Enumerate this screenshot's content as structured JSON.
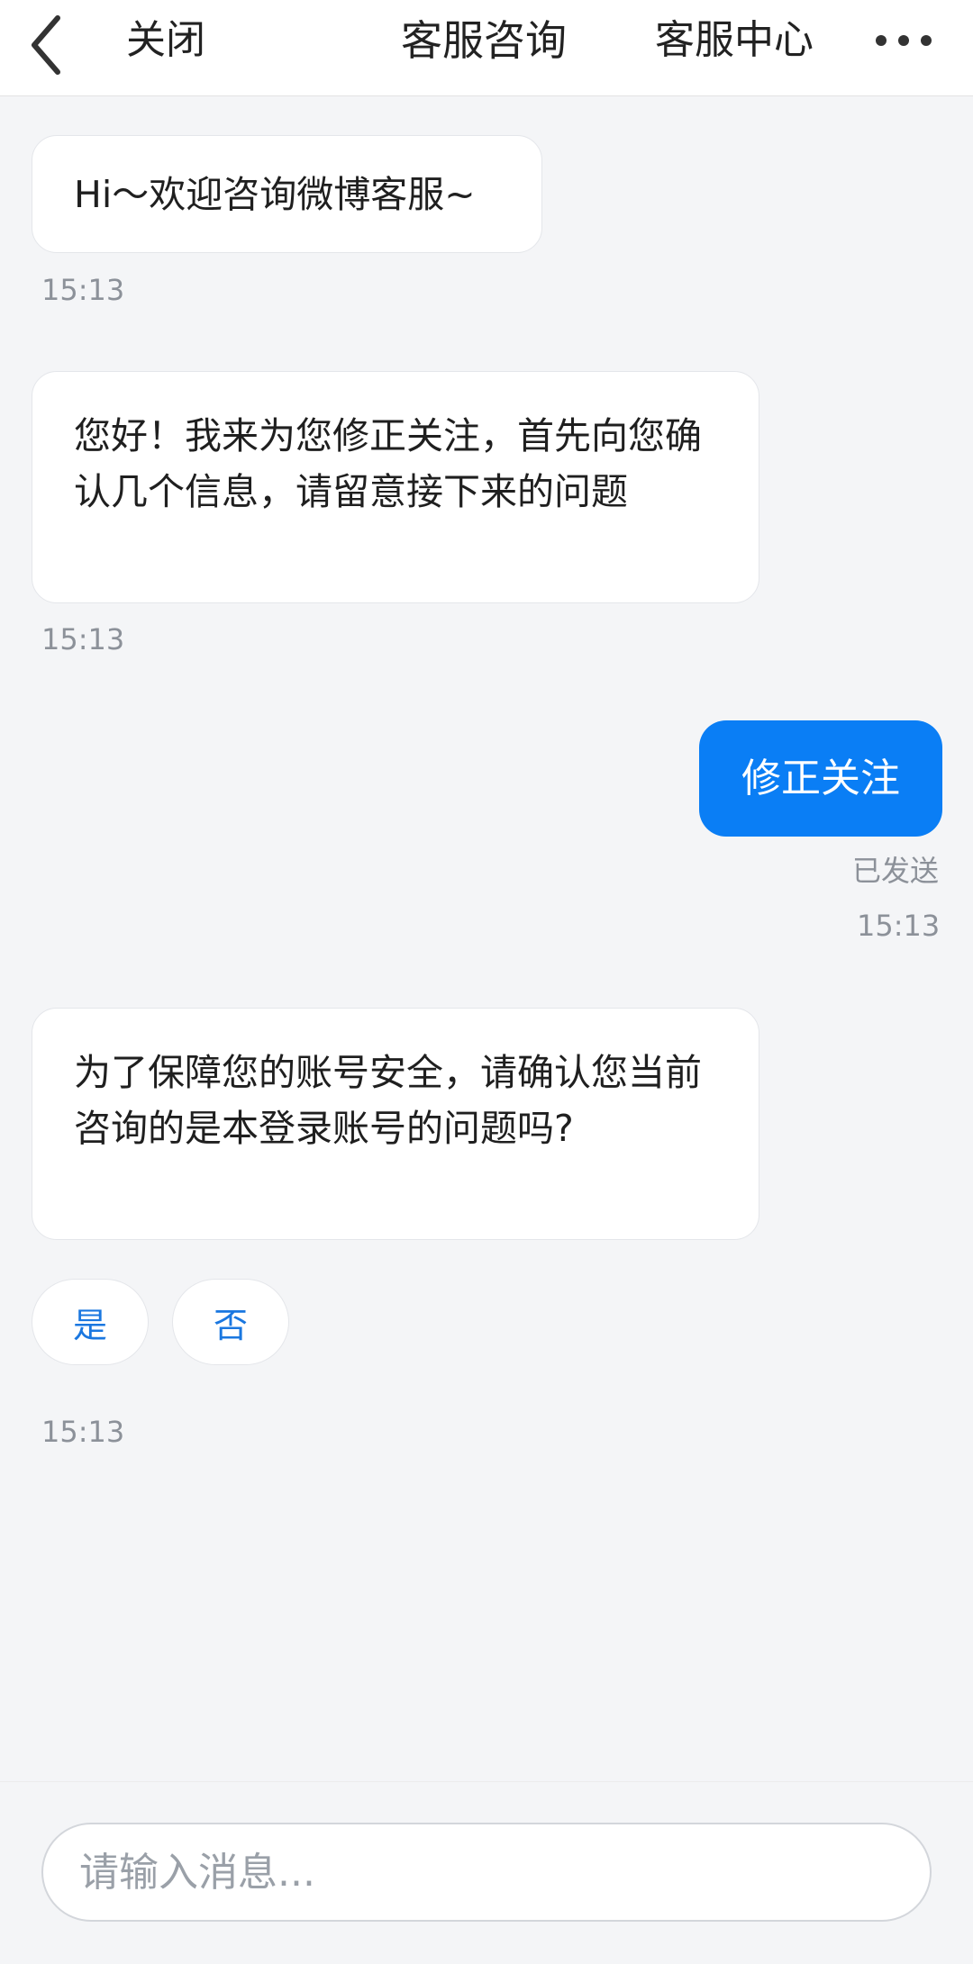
{
  "header": {
    "close_label": "关闭",
    "title": "客服咨询",
    "service_center_label": "客服中心"
  },
  "messages": [
    {
      "text": "Hi～欢迎咨询微博客服~",
      "time": "15:13"
    },
    {
      "text": "您好！我来为您修正关注，首先向您确认几个信息，请留意接下来的问题",
      "time": "15:13"
    },
    {
      "text": "修正关注",
      "status": "已发送",
      "time": "15:13"
    },
    {
      "text": "为了保障您的账号安全，请确认您当前咨询的是本登录账号的问题吗?",
      "time": "15:13"
    }
  ],
  "options": [
    {
      "label": "是"
    },
    {
      "label": "否"
    }
  ],
  "input": {
    "placeholder": "请输入消息..."
  },
  "colors": {
    "accent": "#0a7ef5",
    "option_text": "#1a77e0",
    "background": "#f4f5f7"
  },
  "icons": [
    "back-arrow-icon",
    "more-dots-icon"
  ]
}
